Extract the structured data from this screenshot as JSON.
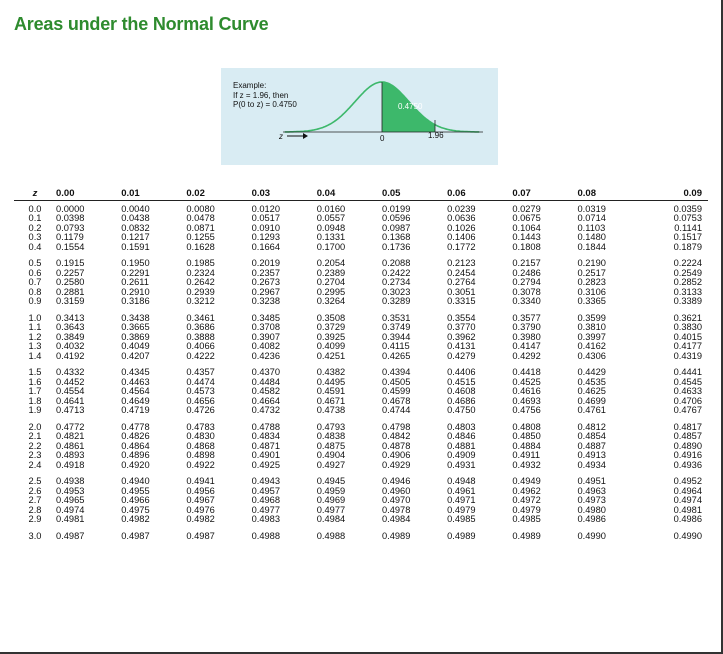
{
  "title": "Areas under the Normal Curve",
  "example": {
    "line1": "Example:",
    "line2": "If z = 1.96, then",
    "line3": "P(0 to z) = 0.4750",
    "z_arrow_label": "z",
    "area_label": "0.4750",
    "tick_zero": "0",
    "tick_z": "1.96",
    "shade_color": "#3db86b",
    "curve_color": "#3db86b"
  },
  "table": {
    "headers": [
      "z",
      "0.00",
      "0.01",
      "0.02",
      "0.03",
      "0.04",
      "0.05",
      "0.06",
      "0.07",
      "0.08",
      "0.09"
    ],
    "rows": [
      [
        "0.0",
        "0.0000",
        "0.0040",
        "0.0080",
        "0.0120",
        "0.0160",
        "0.0199",
        "0.0239",
        "0.0279",
        "0.0319",
        "0.0359"
      ],
      [
        "0.1",
        "0.0398",
        "0.0438",
        "0.0478",
        "0.0517",
        "0.0557",
        "0.0596",
        "0.0636",
        "0.0675",
        "0.0714",
        "0.0753"
      ],
      [
        "0.2",
        "0.0793",
        "0.0832",
        "0.0871",
        "0.0910",
        "0.0948",
        "0.0987",
        "0.1026",
        "0.1064",
        "0.1103",
        "0.1141"
      ],
      [
        "0.3",
        "0.1179",
        "0.1217",
        "0.1255",
        "0.1293",
        "0.1331",
        "0.1368",
        "0.1406",
        "0.1443",
        "0.1480",
        "0.1517"
      ],
      [
        "0.4",
        "0.1554",
        "0.1591",
        "0.1628",
        "0.1664",
        "0.1700",
        "0.1736",
        "0.1772",
        "0.1808",
        "0.1844",
        "0.1879"
      ],
      [
        "0.5",
        "0.1915",
        "0.1950",
        "0.1985",
        "0.2019",
        "0.2054",
        "0.2088",
        "0.2123",
        "0.2157",
        "0.2190",
        "0.2224"
      ],
      [
        "0.6",
        "0.2257",
        "0.2291",
        "0.2324",
        "0.2357",
        "0.2389",
        "0.2422",
        "0.2454",
        "0.2486",
        "0.2517",
        "0.2549"
      ],
      [
        "0.7",
        "0.2580",
        "0.2611",
        "0.2642",
        "0.2673",
        "0.2704",
        "0.2734",
        "0.2764",
        "0.2794",
        "0.2823",
        "0.2852"
      ],
      [
        "0.8",
        "0.2881",
        "0.2910",
        "0.2939",
        "0.2967",
        "0.2995",
        "0.3023",
        "0.3051",
        "0.3078",
        "0.3106",
        "0.3133"
      ],
      [
        "0.9",
        "0.3159",
        "0.3186",
        "0.3212",
        "0.3238",
        "0.3264",
        "0.3289",
        "0.3315",
        "0.3340",
        "0.3365",
        "0.3389"
      ],
      [
        "1.0",
        "0.3413",
        "0.3438",
        "0.3461",
        "0.3485",
        "0.3508",
        "0.3531",
        "0.3554",
        "0.3577",
        "0.3599",
        "0.3621"
      ],
      [
        "1.1",
        "0.3643",
        "0.3665",
        "0.3686",
        "0.3708",
        "0.3729",
        "0.3749",
        "0.3770",
        "0.3790",
        "0.3810",
        "0.3830"
      ],
      [
        "1.2",
        "0.3849",
        "0.3869",
        "0.3888",
        "0.3907",
        "0.3925",
        "0.3944",
        "0.3962",
        "0.3980",
        "0.3997",
        "0.4015"
      ],
      [
        "1.3",
        "0.4032",
        "0.4049",
        "0.4066",
        "0.4082",
        "0.4099",
        "0.4115",
        "0.4131",
        "0.4147",
        "0.4162",
        "0.4177"
      ],
      [
        "1.4",
        "0.4192",
        "0.4207",
        "0.4222",
        "0.4236",
        "0.4251",
        "0.4265",
        "0.4279",
        "0.4292",
        "0.4306",
        "0.4319"
      ],
      [
        "1.5",
        "0.4332",
        "0.4345",
        "0.4357",
        "0.4370",
        "0.4382",
        "0.4394",
        "0.4406",
        "0.4418",
        "0.4429",
        "0.4441"
      ],
      [
        "1.6",
        "0.4452",
        "0.4463",
        "0.4474",
        "0.4484",
        "0.4495",
        "0.4505",
        "0.4515",
        "0.4525",
        "0.4535",
        "0.4545"
      ],
      [
        "1.7",
        "0.4554",
        "0.4564",
        "0.4573",
        "0.4582",
        "0.4591",
        "0.4599",
        "0.4608",
        "0.4616",
        "0.4625",
        "0.4633"
      ],
      [
        "1.8",
        "0.4641",
        "0.4649",
        "0.4656",
        "0.4664",
        "0.4671",
        "0.4678",
        "0.4686",
        "0.4693",
        "0.4699",
        "0.4706"
      ],
      [
        "1.9",
        "0.4713",
        "0.4719",
        "0.4726",
        "0.4732",
        "0.4738",
        "0.4744",
        "0.4750",
        "0.4756",
        "0.4761",
        "0.4767"
      ],
      [
        "2.0",
        "0.4772",
        "0.4778",
        "0.4783",
        "0.4788",
        "0.4793",
        "0.4798",
        "0.4803",
        "0.4808",
        "0.4812",
        "0.4817"
      ],
      [
        "2.1",
        "0.4821",
        "0.4826",
        "0.4830",
        "0.4834",
        "0.4838",
        "0.4842",
        "0.4846",
        "0.4850",
        "0.4854",
        "0.4857"
      ],
      [
        "2.2",
        "0.4861",
        "0.4864",
        "0.4868",
        "0.4871",
        "0.4875",
        "0.4878",
        "0.4881",
        "0.4884",
        "0.4887",
        "0.4890"
      ],
      [
        "2.3",
        "0.4893",
        "0.4896",
        "0.4898",
        "0.4901",
        "0.4904",
        "0.4906",
        "0.4909",
        "0.4911",
        "0.4913",
        "0.4916"
      ],
      [
        "2.4",
        "0.4918",
        "0.4920",
        "0.4922",
        "0.4925",
        "0.4927",
        "0.4929",
        "0.4931",
        "0.4932",
        "0.4934",
        "0.4936"
      ],
      [
        "2.5",
        "0.4938",
        "0.4940",
        "0.4941",
        "0.4943",
        "0.4945",
        "0.4946",
        "0.4948",
        "0.4949",
        "0.4951",
        "0.4952"
      ],
      [
        "2.6",
        "0.4953",
        "0.4955",
        "0.4956",
        "0.4957",
        "0.4959",
        "0.4960",
        "0.4961",
        "0.4962",
        "0.4963",
        "0.4964"
      ],
      [
        "2.7",
        "0.4965",
        "0.4966",
        "0.4967",
        "0.4968",
        "0.4969",
        "0.4970",
        "0.4971",
        "0.4972",
        "0.4973",
        "0.4974"
      ],
      [
        "2.8",
        "0.4974",
        "0.4975",
        "0.4976",
        "0.4977",
        "0.4977",
        "0.4978",
        "0.4979",
        "0.4979",
        "0.4980",
        "0.4981"
      ],
      [
        "2.9",
        "0.4981",
        "0.4982",
        "0.4982",
        "0.4983",
        "0.4984",
        "0.4984",
        "0.4985",
        "0.4985",
        "0.4986",
        "0.4986"
      ],
      [
        "3.0",
        "0.4987",
        "0.4987",
        "0.4987",
        "0.4988",
        "0.4988",
        "0.4989",
        "0.4989",
        "0.4989",
        "0.4990",
        "0.4990"
      ]
    ]
  }
}
